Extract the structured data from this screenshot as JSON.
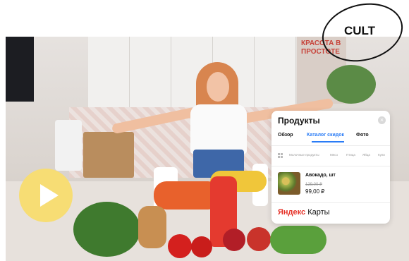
{
  "logo": {
    "text": "CULT"
  },
  "poster": {
    "text": "КРАСОТА В ПРОСТОТЕ"
  },
  "video": {
    "play_icon": "play-icon"
  },
  "card": {
    "title": "Продукты",
    "close_icon": "close-icon",
    "tabs": [
      {
        "label": "Обзор",
        "active": false
      },
      {
        "label": "Каталог скидок",
        "active": true
      },
      {
        "label": "Фото",
        "active": false
      }
    ],
    "categories_icon": "grid-icon",
    "categories": [
      "Молочные продукты",
      "Мясо",
      "Птица",
      "Яйца",
      "Купи"
    ],
    "product": {
      "name": "Авокадо, шт",
      "old_price": "129,00 ₽",
      "price": "99,00 ₽"
    },
    "brand": {
      "part1": "Яндекс",
      "part2": "Карты"
    }
  },
  "colors": {
    "accent": "#2a7cf6",
    "play_button": "#f7dd74",
    "brand_red": "#e52f25"
  }
}
